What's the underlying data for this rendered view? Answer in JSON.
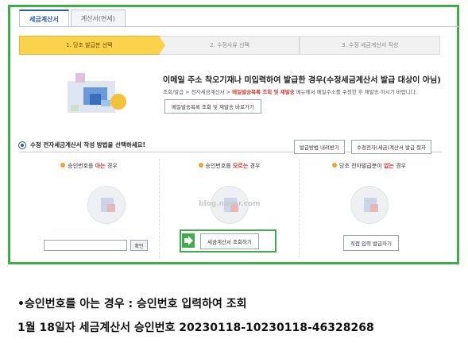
{
  "tabs": [
    "세금계산서",
    "계산서(면세)"
  ],
  "steps": [
    "1. 당초 발급분 선택",
    "2. 수정사유 선택",
    "3. 수정 세금계산서 작성"
  ],
  "hero": {
    "title_pre": "이메일 주소 착오기재나 미입력하여 발급한 경우",
    "title_red": "(수정세금계산서 발급 대상이 아님)",
    "desc_pre": "조회/발급 > 전자세금계산서 >",
    "desc_red": "메일발송목록 조회 및 재발송",
    "desc_post": "메뉴에서 메일주소를 수정한 후 재발송 하시기 바랍니다.",
    "button": "메일발송목록 조회 및 재발송 바로가기"
  },
  "section": {
    "title": "수정 전자세금계산서 작성 방법을 선택하세요!",
    "btn_guide": "발급방법 내려받기",
    "btn_lookup": "수정전자(세금)계산서 발급 절차"
  },
  "options": [
    {
      "pre": "승인번호를",
      "red": "아는",
      "post": "경우"
    },
    {
      "pre": "승인번호를",
      "red": "모르는",
      "post": "경우"
    },
    {
      "pre": "당초 전자발급분이",
      "red": "없는",
      "post": "경우"
    }
  ],
  "buttons": {
    "confirm": "확인",
    "lookup": "세금계산서 조회하기",
    "direct": "직접 입력 발급하기"
  },
  "input": {
    "value": ""
  },
  "watermark": "blog.naver.com",
  "captions": {
    "line1": "•승인번호를 아는 경우 : 승인번호 입력하여 조회",
    "line2": "1월 18일자 세금계산서 승인번호 20230118-10230118-46328268"
  },
  "colors": {
    "highlight": "#3fae4a",
    "accent": "#2b5aa8",
    "warn": "#d8342a",
    "step": "#fbd24c"
  }
}
